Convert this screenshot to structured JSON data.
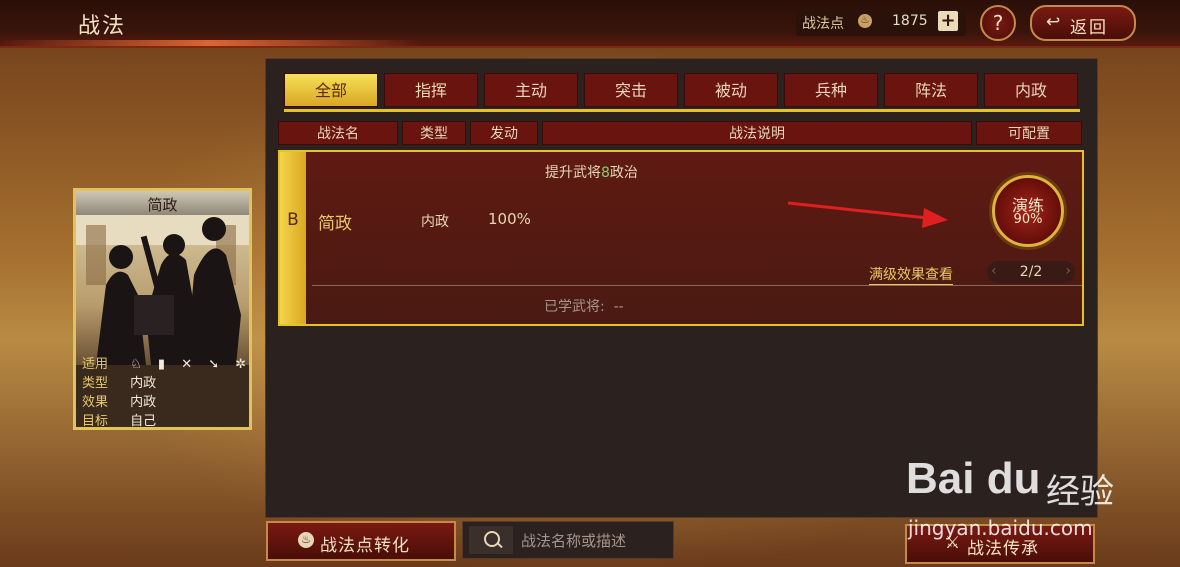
{
  "header": {
    "title": "战法",
    "points_label": "战法点",
    "points_icon": "flame-icon",
    "points_value": "1875",
    "add_label": "+",
    "help_label": "?",
    "back_label": "返回",
    "back_icon": "return-arrow-icon"
  },
  "tabs": [
    "全部",
    "指挥",
    "主动",
    "突击",
    "被动",
    "兵种",
    "阵法",
    "内政"
  ],
  "active_tab": 0,
  "columns": [
    "战法名",
    "类型",
    "发动",
    "战法说明",
    "可配置"
  ],
  "skill": {
    "grade": "B",
    "name": "简政",
    "type": "内政",
    "rate": "100%",
    "desc_prefix": "提升武将",
    "desc_highlight": "8",
    "desc_suffix": "政治",
    "practice_label": "演练",
    "practice_percent": "90%",
    "max_effect_link": "满级效果查看",
    "page": "2/2",
    "learned_label": "已学武将:",
    "learned_value": "--"
  },
  "card": {
    "name": "简政",
    "rows": [
      {
        "key": "适用",
        "value": "♘ ▮ ✕ ➘ ✲"
      },
      {
        "key": "类型",
        "value": "内政"
      },
      {
        "key": "效果",
        "value": "内政"
      },
      {
        "key": "目标",
        "value": "自己"
      }
    ]
  },
  "bottom": {
    "convert_label": "战法点转化",
    "search_placeholder": "战法名称或描述",
    "inherit_label": "战法传承"
  },
  "watermark": {
    "logo": "Bai du",
    "cn": "经验",
    "url": "jingyan.baidu.com"
  },
  "colors": {
    "accent_gold": "#e6c229",
    "deep_red": "#6a1410",
    "highlight_green": "#7bd46a"
  }
}
